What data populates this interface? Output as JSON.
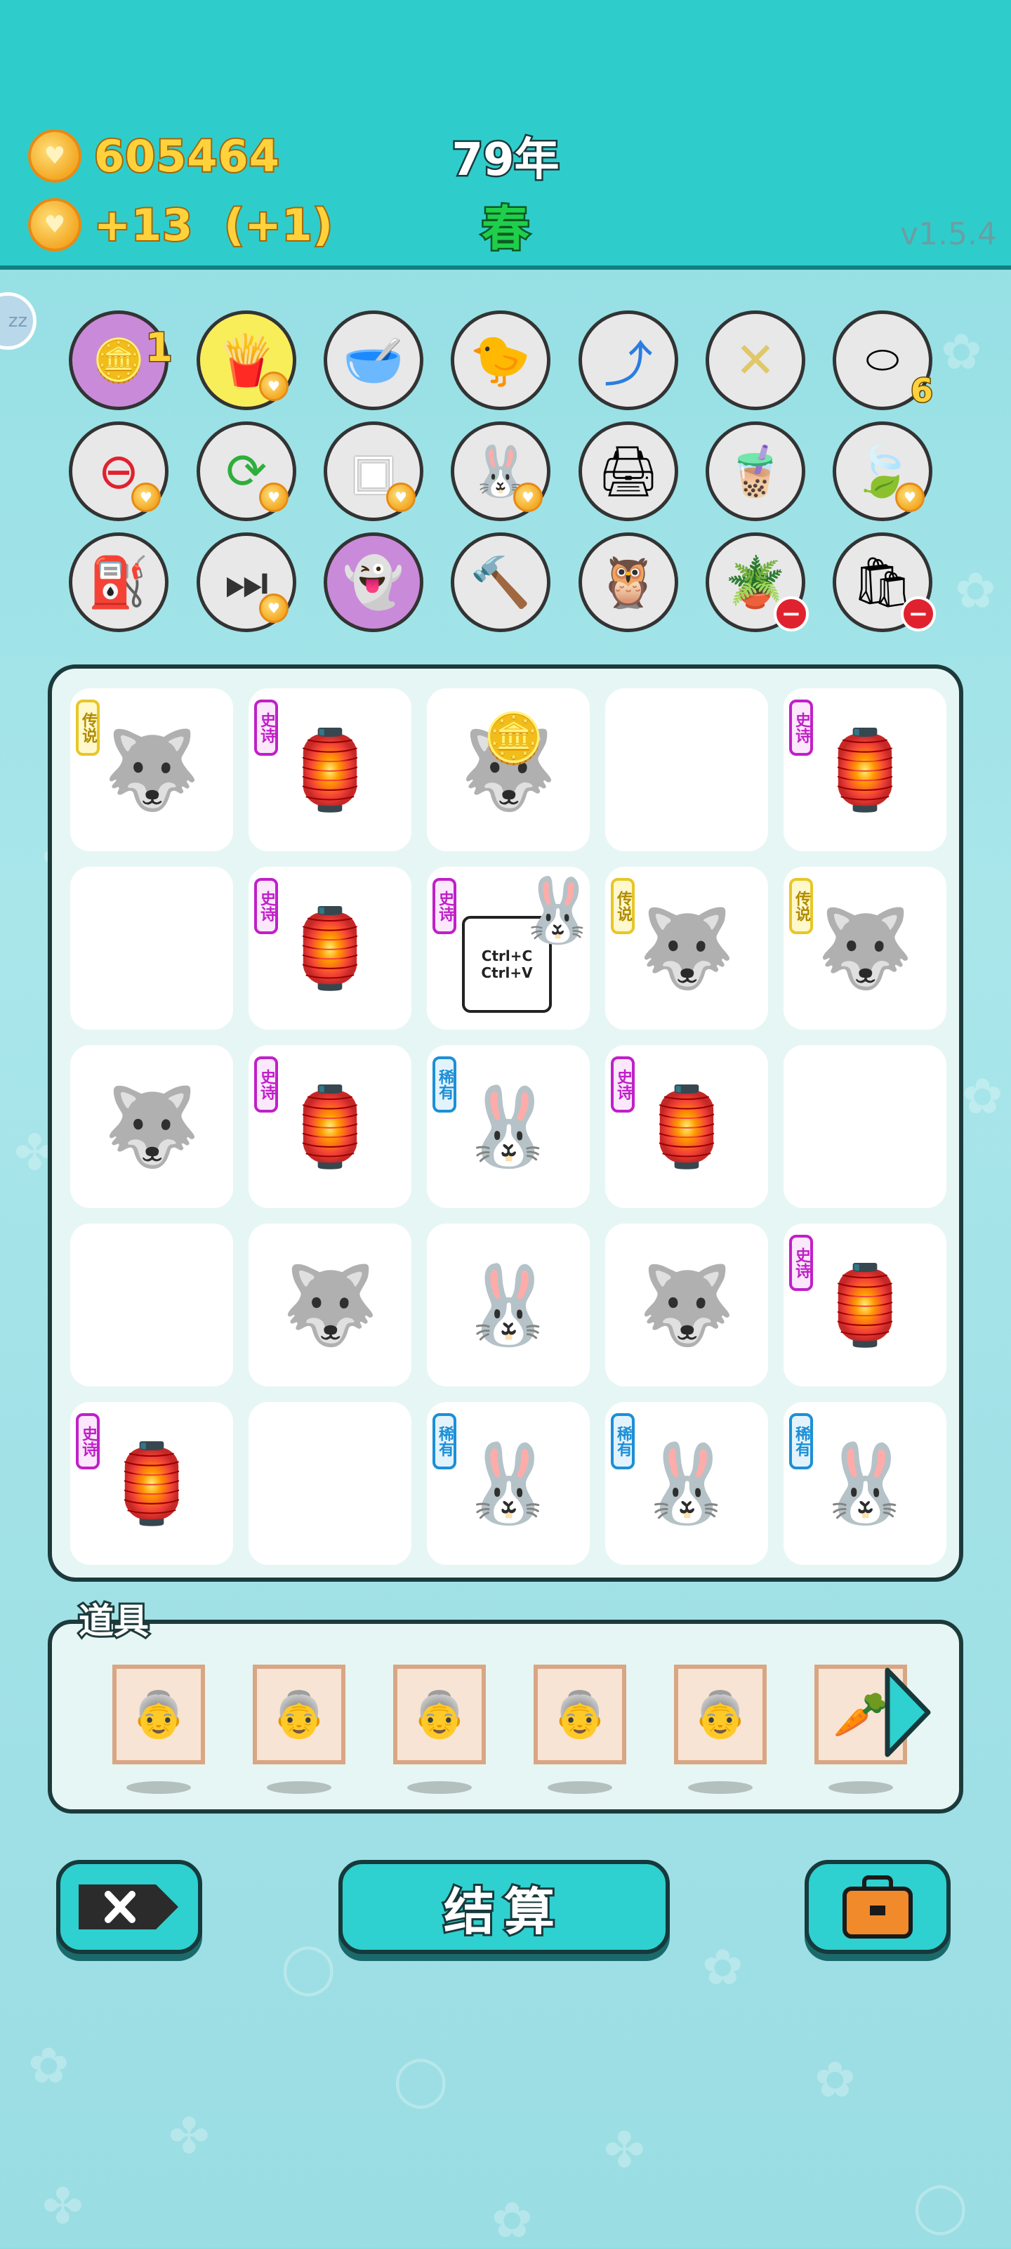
{
  "header": {
    "coins": "605464",
    "income": "+13",
    "income_bonus": "(+1)",
    "year": "79年",
    "season": "春",
    "version": "v1.5.4"
  },
  "sleep_badge": "zz",
  "items": [
    {
      "name": "egg-maker-item",
      "icon": "coin-egg",
      "count": "1",
      "color": "#c98ad9"
    },
    {
      "name": "fries-item",
      "icon": "french-fries",
      "color": "#f7ee5a"
    },
    {
      "name": "pet-bowl-item",
      "icon": "bone-bowl",
      "color": "#e8e8e8"
    },
    {
      "name": "chick-egg-item",
      "icon": "chick",
      "color": "#e8e8e8"
    },
    {
      "name": "growth-arrow-item",
      "icon": "up-arrow-card",
      "color": "#e8e8e8"
    },
    {
      "name": "chopsticks-item",
      "icon": "chopsticks",
      "color": "#e8e8e8"
    },
    {
      "name": "egg-tray-item",
      "icon": "egg-tray",
      "count": "6",
      "color": "#e8e8e8"
    },
    {
      "name": "minus-item",
      "icon": "remove-circle",
      "color": "#e8e8e8"
    },
    {
      "name": "refresh-item",
      "icon": "recycle-arrows",
      "color": "#e8e8e8"
    },
    {
      "name": "sugar-cubes-item",
      "icon": "sugar-cubes",
      "color": "#e8e8e8"
    },
    {
      "name": "bunny-item",
      "icon": "bunny",
      "color": "#e8e8e8"
    },
    {
      "name": "printer-item",
      "icon": "printer-warning",
      "color": "#e8e8e8"
    },
    {
      "name": "bubble-tea-item",
      "icon": "bubble-tea",
      "color": "#e8e8e8"
    },
    {
      "name": "leaf-item",
      "icon": "leaf",
      "color": "#e8e8e8"
    },
    {
      "name": "pump-item",
      "icon": "air-pump",
      "color": "#e8e8e8"
    },
    {
      "name": "skip-item",
      "icon": "skip-forward",
      "color": "#e8e8e8"
    },
    {
      "name": "ghost-item",
      "icon": "ghost",
      "color": "#c98ad9"
    },
    {
      "name": "hammer-item",
      "icon": "hammer",
      "color": "#e8e8e8"
    },
    {
      "name": "owl-item",
      "icon": "owl",
      "color": "#e8e8e8"
    },
    {
      "name": "flower-pot-item",
      "icon": "flower-pot",
      "color": "#e8e8e8"
    },
    {
      "name": "sack-item",
      "icon": "grain-sack",
      "color": "#e8e8e8"
    }
  ],
  "board": {
    "rarity_labels": {
      "legend": "传说",
      "epic": "史诗",
      "rare": "稀有"
    },
    "cells": [
      {
        "symbol": "husky-king",
        "rarity": "legend"
      },
      {
        "symbol": "bunny-house",
        "rarity": "epic"
      },
      {
        "symbol": "husky-king-coins",
        "rarity": ""
      },
      {
        "symbol": "",
        "rarity": ""
      },
      {
        "symbol": "bunny-house",
        "rarity": "epic"
      },
      {
        "symbol": "",
        "rarity": ""
      },
      {
        "symbol": "bunny-house",
        "rarity": "epic"
      },
      {
        "symbol": "copy-bunny",
        "rarity": "epic"
      },
      {
        "symbol": "husky-king",
        "rarity": "legend"
      },
      {
        "symbol": "husky-king",
        "rarity": "legend"
      },
      {
        "symbol": "husky-king",
        "rarity": ""
      },
      {
        "symbol": "bunny-house",
        "rarity": "epic"
      },
      {
        "symbol": "bunny",
        "rarity": "rare"
      },
      {
        "symbol": "bunny-house",
        "rarity": "epic"
      },
      {
        "symbol": "",
        "rarity": ""
      },
      {
        "symbol": "",
        "rarity": ""
      },
      {
        "symbol": "husky-king",
        "rarity": ""
      },
      {
        "symbol": "bunny",
        "rarity": ""
      },
      {
        "symbol": "husky-king",
        "rarity": ""
      },
      {
        "symbol": "bunny-house",
        "rarity": "epic"
      },
      {
        "symbol": "bunny-house",
        "rarity": "epic"
      },
      {
        "symbol": "",
        "rarity": ""
      },
      {
        "symbol": "bunny",
        "rarity": "rare"
      },
      {
        "symbol": "bunny",
        "rarity": "rare"
      },
      {
        "symbol": "bunny",
        "rarity": "rare"
      }
    ],
    "copy_card_text": [
      "Ctrl+C",
      "Ctrl+V"
    ]
  },
  "props": {
    "title": "道具",
    "items": [
      {
        "icon": "granny-portrait"
      },
      {
        "icon": "granny-portrait"
      },
      {
        "icon": "granny-portrait"
      },
      {
        "icon": "granny-portrait"
      },
      {
        "icon": "granny-portrait"
      },
      {
        "icon": "carrot-portrait"
      }
    ]
  },
  "buttons": {
    "close_icon": "close-tag-icon",
    "settle_label": "结算",
    "bag_icon": "briefcase-icon"
  },
  "colors": {
    "header_bg": "#2ecdcc",
    "coin_gold": "#ffd23c",
    "season_green": "#1fcf4b",
    "button_teal": "#2ed1cf"
  }
}
